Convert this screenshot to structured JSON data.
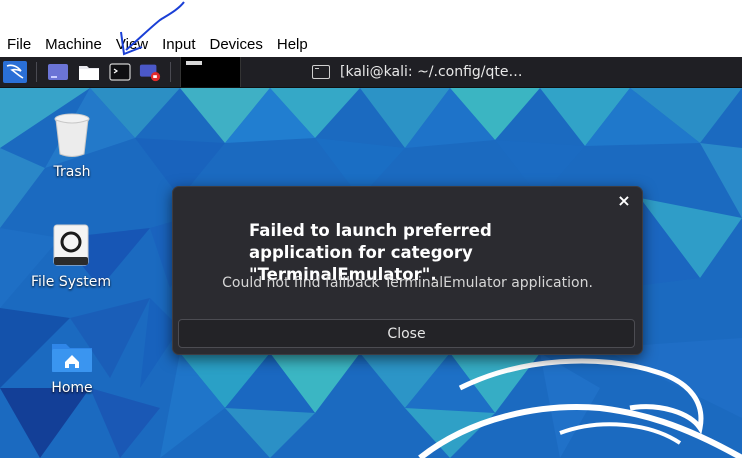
{
  "vbox": {
    "menu": [
      "File",
      "Machine",
      "View",
      "Input",
      "Devices",
      "Help"
    ]
  },
  "panel": {
    "task_title": "[kali@kali: ~/.config/qte…",
    "icons": [
      "kali-menu-icon",
      "show-desktop-icon",
      "file-manager-icon",
      "terminal-icon",
      "screen-recorder-icon"
    ]
  },
  "desktop": {
    "icons": [
      {
        "label": "Trash",
        "icon": "trash-icon"
      },
      {
        "label": "File System",
        "icon": "drive-icon"
      },
      {
        "label": "Home",
        "icon": "home-folder-icon"
      }
    ]
  },
  "dialog": {
    "primary": "Failed to launch preferred application for category \"TerminalEmulator\".",
    "secondary": "Could not find fallback TerminalEmulator application.",
    "close_label": "Close",
    "close_glyph": "×"
  },
  "colors": {
    "panel_bg": "#1f1f24",
    "dialog_bg": "#2b2b30",
    "annotation": "#1a3fd6"
  }
}
